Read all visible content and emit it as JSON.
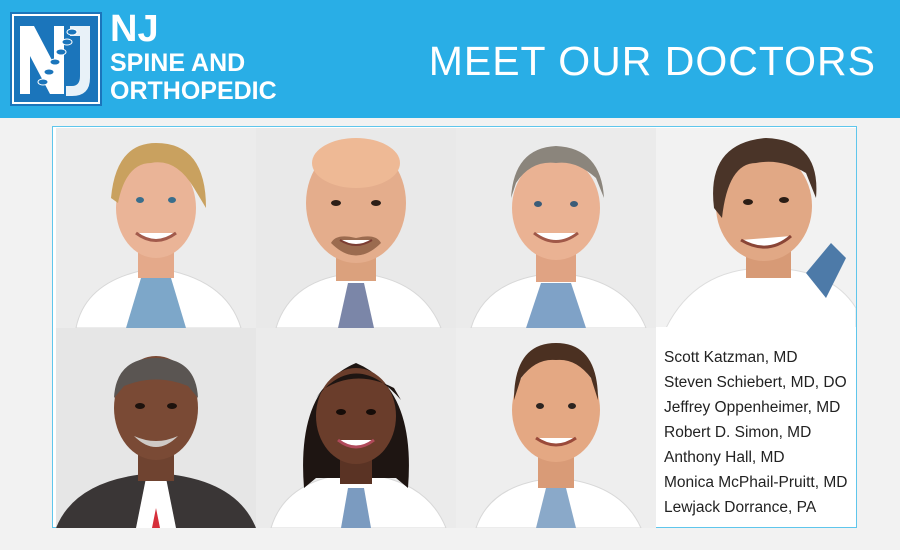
{
  "brand": {
    "nj": "NJ",
    "line2": "SPINE AND",
    "line3": "ORTHOPEDIC"
  },
  "headline": "MEET OUR DOCTORS",
  "doctors": [
    "Scott Katzman, MD",
    "Steven Schiebert, MD, DO",
    "Jeffrey Oppenheimer, MD",
    "Robert D. Simon, MD",
    "Anthony Hall, MD",
    "Monica McPhail-Pruitt, MD",
    "Lewjack Dorrance, PA"
  ],
  "colors": {
    "header_bg": "#29aee6",
    "frame_border": "#5fc6ec",
    "page_bg": "#f2f2f2"
  }
}
